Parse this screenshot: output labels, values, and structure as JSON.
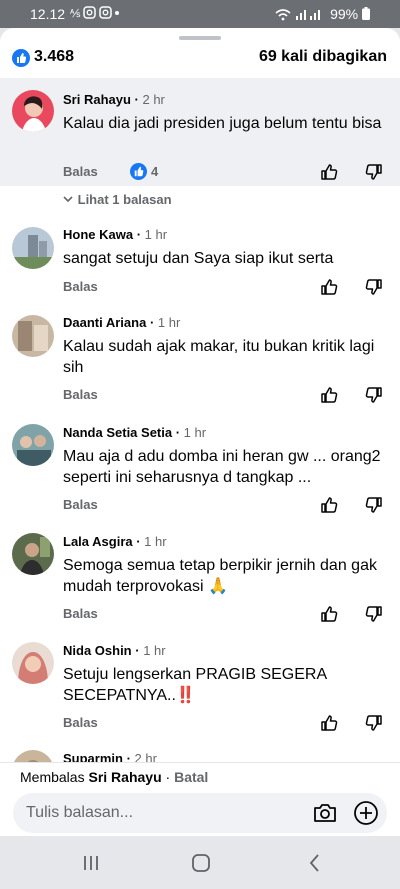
{
  "status_bar": {
    "time": "12.12",
    "battery": "99%"
  },
  "header": {
    "like_count": "3.468",
    "share_count": "69 kali dibagikan"
  },
  "comments": [
    {
      "name": "Sri Rahayu",
      "time": "2 hr",
      "text": "Kalau dia jadi presiden juga belum tentu bisa",
      "reply_label": "Balas",
      "like_count": "4",
      "view_replies": "Lihat 1 balasan"
    },
    {
      "name": "Hone Kawa",
      "time": "1 hr",
      "text": "sangat setuju dan Saya siap ikut serta",
      "reply_label": "Balas"
    },
    {
      "name": "Daanti Ariana",
      "time": "1 hr",
      "text": "Kalau sudah ajak makar, itu bukan kritik lagi sih",
      "reply_label": "Balas"
    },
    {
      "name": "Nanda Setia Setia",
      "time": "1 hr",
      "text": "Mau aja d adu domba ini heran gw ... orang2 seperti ini seharusnya d tangkap ...",
      "reply_label": "Balas"
    },
    {
      "name": "Lala Asgira",
      "time": "1 hr",
      "text": "Semoga semua tetap berpikir jernih dan gak mudah terprovokasi 🙏",
      "reply_label": "Balas"
    },
    {
      "name": "Nida Oshin",
      "time": "1 hr",
      "text": "Setuju lengserkan PRAGIB SEGERA SECEPATNYA..‼️",
      "reply_label": "Balas"
    },
    {
      "name": "Suparmin",
      "time": "2 hr"
    }
  ],
  "reply_bar": {
    "prefix": "Membalas",
    "target": "Sri Rahayu",
    "cancel": "Batal",
    "placeholder": "Tulis balasan..."
  },
  "icons": {
    "like": "thumbs-up-icon",
    "dislike": "thumbs-down-icon",
    "camera": "camera-icon",
    "plus": "plus-circle-icon",
    "chevron": "chevron-down-icon"
  },
  "colors": {
    "brand_blue": "#1877f2",
    "highlight_bg": "#eef0f3",
    "muted_text": "#65676b"
  }
}
